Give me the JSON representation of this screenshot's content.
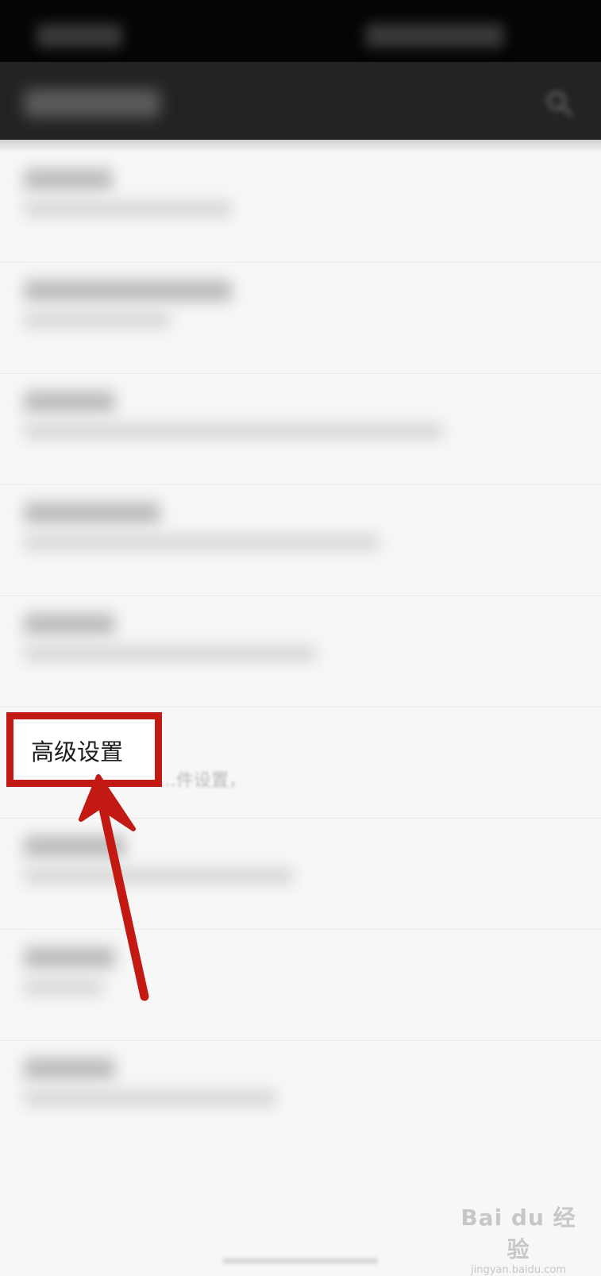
{
  "highlighted_item": {
    "label": "高级设置",
    "partial_text": "…件设置，"
  },
  "watermark": {
    "brand": "Bai du 经验",
    "url": "jingyan.baidu.com"
  },
  "colors": {
    "annotation_red": "#c21a12",
    "app_bar": "#232323",
    "status_bar": "#050505"
  },
  "icons": [
    "search-icon"
  ]
}
